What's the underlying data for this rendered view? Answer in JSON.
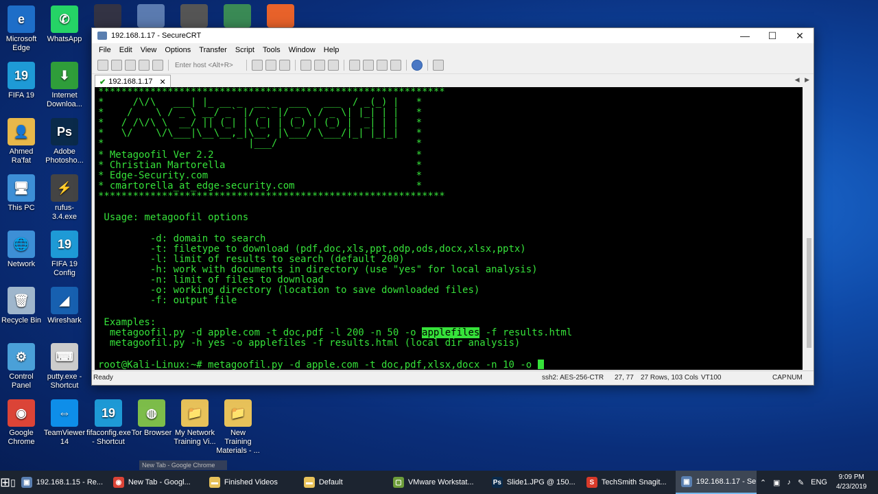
{
  "desktop": {
    "icons": [
      {
        "label": "Microsoft Edge",
        "icon": "edge-icon",
        "color": "#1e6ec8",
        "glyph": "e"
      },
      {
        "label": "WhatsApp",
        "icon": "whatsapp-icon",
        "color": "#25d366",
        "glyph": "✆"
      },
      {
        "label": "FIFA 19",
        "icon": "fifa-icon",
        "color": "#1e9ad6",
        "glyph": "19"
      },
      {
        "label": "Internet Downloa...",
        "icon": "idm-icon",
        "color": "#2f9d3a",
        "glyph": "⬇"
      },
      {
        "label": "Ahmed Ra'fat",
        "icon": "user-folder-icon",
        "color": "#e8b84a",
        "glyph": "👤"
      },
      {
        "label": "Adobe Photosho...",
        "icon": "photoshop-icon",
        "color": "#0a2a4a",
        "glyph": "Ps"
      },
      {
        "label": "This PC",
        "icon": "computer-icon",
        "color": "#3d8fd6",
        "glyph": "🖥"
      },
      {
        "label": "rufus-3.4.exe",
        "icon": "usb-icon",
        "color": "#444444",
        "glyph": "⚡"
      },
      {
        "label": "Network",
        "icon": "network-icon",
        "color": "#3d8fd6",
        "glyph": "🌐"
      },
      {
        "label": "FIFA 19 Config",
        "icon": "fifa-config-icon",
        "color": "#1e9ad6",
        "glyph": "19"
      },
      {
        "label": "Recycle Bin",
        "icon": "recycle-bin-icon",
        "color": "#9fb6cc",
        "glyph": "🗑"
      },
      {
        "label": "Wireshark",
        "icon": "wireshark-icon",
        "color": "#1760b0",
        "glyph": "◢"
      },
      {
        "label": "Control Panel",
        "icon": "control-panel-icon",
        "color": "#4aa0d8",
        "glyph": "⚙"
      },
      {
        "label": "putty.exe - Shortcut",
        "icon": "putty-icon",
        "color": "#cccccc",
        "glyph": "⌨"
      },
      {
        "label": "Google Chrome",
        "icon": "chrome-icon",
        "color": "#db4437",
        "glyph": "◉"
      },
      {
        "label": "TeamViewer 14",
        "icon": "teamviewer-icon",
        "color": "#0e8ee9",
        "glyph": "⇔"
      },
      {
        "label": "fifaconfig.exe - Shortcut",
        "icon": "fifaconfig-icon",
        "color": "#1e9ad6",
        "glyph": "19"
      },
      {
        "label": "Tor Browser",
        "icon": "tor-icon",
        "color": "#7dbd4a",
        "glyph": "◍"
      },
      {
        "label": "My Network Training Vi...",
        "icon": "folder-icon",
        "color": "#e8c25a",
        "glyph": "📁"
      },
      {
        "label": "New Training Materials - ...",
        "icon": "folder-icon",
        "color": "#e8c25a",
        "glyph": "📁"
      }
    ]
  },
  "window": {
    "title": "192.168.1.17 - SecureCRT",
    "menu": [
      "File",
      "Edit",
      "View",
      "Options",
      "Transfer",
      "Script",
      "Tools",
      "Window",
      "Help"
    ],
    "host_placeholder": "Enter host <Alt+R>",
    "tab_label": "192.168.1.17",
    "terminal_lines": {
      "stars": "************************************************************",
      "art1": "*     /\\/\\   ___| |_ __ _  __ _  ___   ___  / _(_) |   *",
      "art2": "*    /    \\ / _ \\ __/ _` |/ _` |/ _ \\ / _ \\| |_| | |   *",
      "art3": "*   / /\\/\\ \\  __/ || (_| | (_| | (_) | (_) |  _| | |   *",
      "art4": "*   \\/    \\/\\___|\\__\\__,_|\\__, |\\___/ \\___/|_| |_|_|   *",
      "art5": "*                         |___/                        *",
      "ver": "* Metagoofil Ver 2.2                                   *",
      "author": "* Christian Martorella                                 *",
      "site": "* Edge-Security.com                                    *",
      "email": "* cmartorella_at_edge-security.com                     *",
      "usage": " Usage: metagoofil options",
      "opt_d": "         -d: domain to search",
      "opt_t": "         -t: filetype to download (pdf,doc,xls,ppt,odp,ods,docx,xlsx,pptx)",
      "opt_l": "         -l: limit of results to search (default 200)",
      "opt_h": "         -h: work with documents in directory (use \"yes\" for local analysis)",
      "opt_n": "         -n: limit of files to download",
      "opt_o": "         -o: working directory (location to save downloaded files)",
      "opt_f": "         -f: output file",
      "examples": " Examples:",
      "ex1_a": "  metagoofil.py -d apple.com -t doc,pdf -l 200 -n 50 -o ",
      "ex1_hl": "applefiles",
      "ex1_b": " -f results.html",
      "ex2": "  metagoofil.py -h yes -o applefiles -f results.html (local dir analysis)",
      "prompt": "root@Kali-Linux:~# metagoofil.py -d apple.com -t doc,pdf,xlsx,docx -n 10 -o "
    },
    "status": {
      "ready": "Ready",
      "cipher": "ssh2: AES-256-CTR",
      "pos": "27, 77",
      "size": "27 Rows, 103 Cols",
      "emu": "VT100",
      "cap": "CAP",
      "num": "NUM"
    }
  },
  "taskbar": {
    "tooltip": "New Tab - Google Chrome",
    "items": [
      {
        "label": "192.168.1.15 - Re...",
        "icon": "securecrt-icon",
        "color": "#5a7fb0",
        "glyph": "▣"
      },
      {
        "label": "New Tab - Googl...",
        "icon": "chrome-icon",
        "color": "#db4437",
        "glyph": "◉"
      },
      {
        "label": "Finished Videos",
        "icon": "folder-icon",
        "color": "#e8c25a",
        "glyph": "▬"
      },
      {
        "label": "Default",
        "icon": "folder-icon",
        "color": "#e8c25a",
        "glyph": "▬"
      },
      {
        "label": "VMware Workstat...",
        "icon": "vmware-icon",
        "color": "#6d9d3a",
        "glyph": "▢"
      },
      {
        "label": "Slide1.JPG @ 150...",
        "icon": "photoshop-icon",
        "color": "#0a2a4a",
        "glyph": "Ps"
      },
      {
        "label": "TechSmith Snagit...",
        "icon": "snagit-icon",
        "color": "#d83a2a",
        "glyph": "S"
      },
      {
        "label": "192.168.1.17 - Se...",
        "icon": "securecrt-icon",
        "color": "#5a7fb0",
        "glyph": "▣"
      }
    ],
    "lang": "ENG",
    "time": "9:09 PM",
    "date": "4/23/2019"
  }
}
